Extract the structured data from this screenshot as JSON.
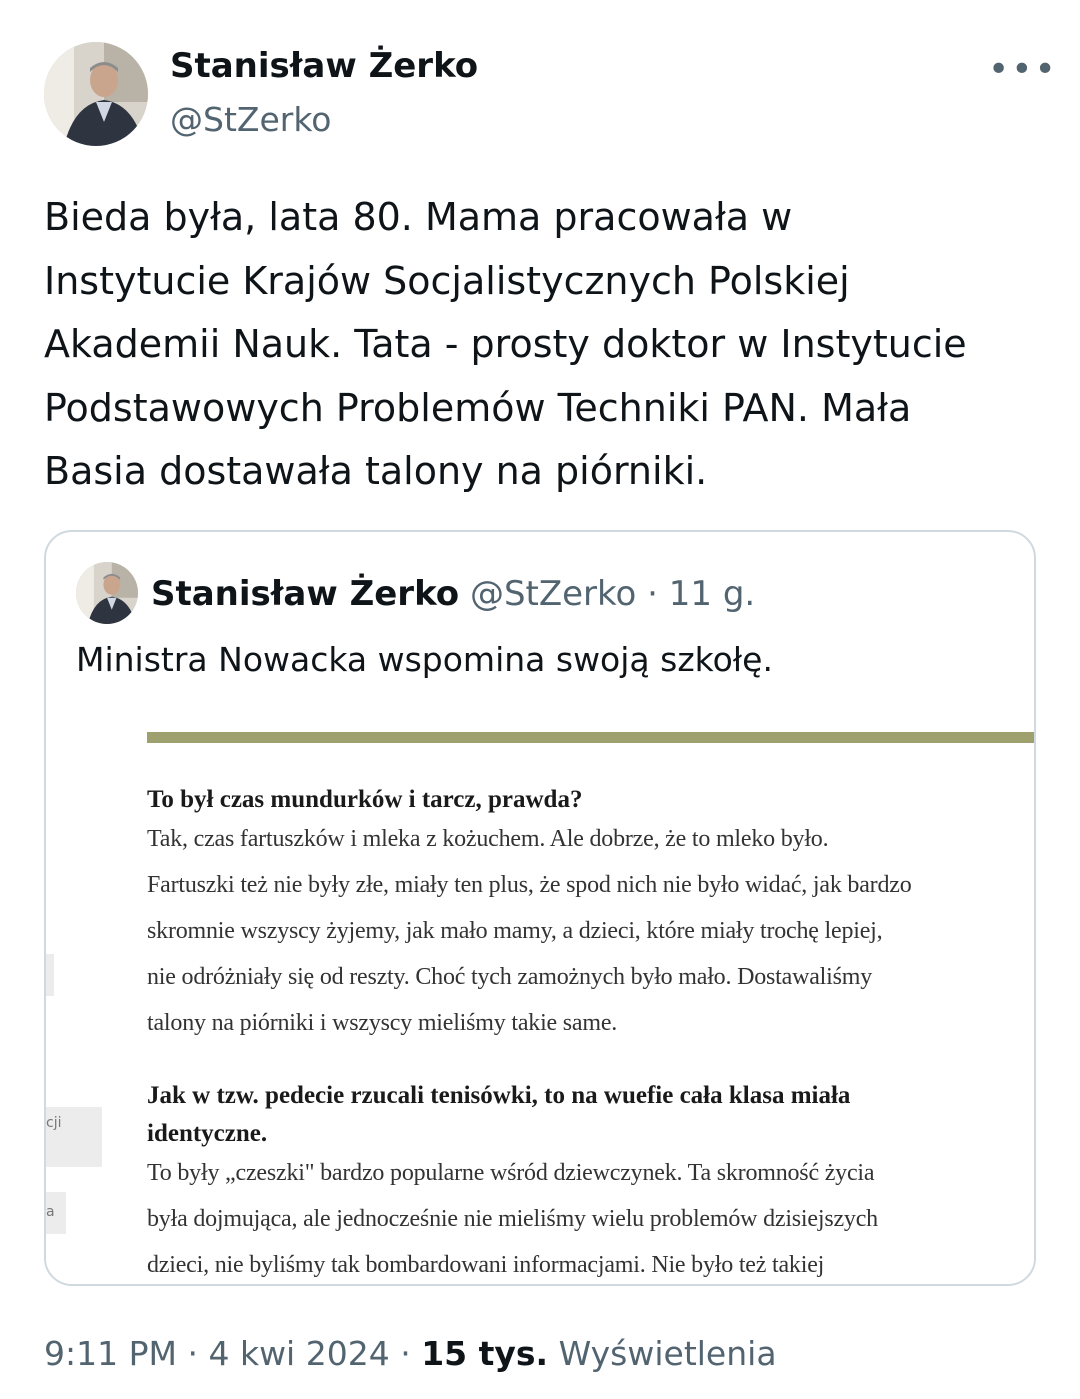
{
  "author": {
    "name": "Stanisław Żerko",
    "handle": "@StZerko"
  },
  "more_label": "•••",
  "tweet_lines": [
    "Bieda była, lata 80. Mama pracowała w",
    "Instytucie Krajów Socjalistycznych Polskiej",
    "Akademii Nauk. Tata - prosty doktor w Instytucie",
    "Podstawowych Problemów Techniki PAN. Mała",
    "Basia dostawała talony na piórniki."
  ],
  "quote": {
    "name": "Stanisław Żerko",
    "handle": "@StZerko",
    "separator": "·",
    "time": "11 g.",
    "text": "Ministra Nowacka wspomina swoją szkołę.",
    "article": {
      "question1": "To był czas mundurków i tarcz, prawda?",
      "answer1": [
        "Tak, czas fartuszków i mleka z kożuchem. Ale dobrze, że to mleko było.",
        "Fartuszki też nie były złe, miały ten plus, że spod nich nie było widać, jak bardzo",
        "skromnie wszyscy żyjemy, jak mało mamy, a dzieci, które miały trochę lepiej,",
        "nie odróżniały się od reszty. Choć tych zamożnych było mało. Dostawaliśmy",
        "talony na piórniki i wszyscy mieliśmy takie same."
      ],
      "question2": [
        "Jak w tzw. pedecie rzucali tenisówki, to na wuefie cała klasa miała",
        "identyczne."
      ],
      "answer2": [
        "To były „czeszki\" bardzo popularne wśród dziewczynek. Ta skromność życia",
        "była dojmująca, ale jednocześnie nie mieliśmy wielu problemów dzisiejszych",
        "dzieci, nie byliśmy tak bombardowani informacjami. Nie było też takiej"
      ],
      "side_text_1": "cji",
      "side_text_2": "a"
    }
  },
  "footer": {
    "time": "9:11 PM",
    "date": "4 kwi 2024",
    "separator": "·",
    "views_count": "15 tys.",
    "views_label": "Wyświetlenia"
  }
}
